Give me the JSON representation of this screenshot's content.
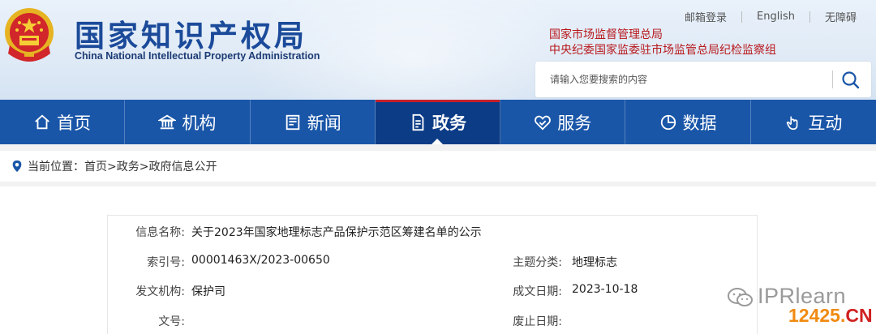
{
  "header": {
    "site_title": "国家知识产权局",
    "site_subtitle": "China National Intellectual Property Administration",
    "top_links": [
      "邮箱登录",
      "English",
      "无障碍"
    ],
    "org_line1": "国家市场监督管理总局",
    "org_line2": "中央纪委国家监委驻市场监管总局纪检监察组",
    "search_placeholder": "请输入您要搜索的内容"
  },
  "nav": {
    "items": [
      {
        "label": "首页",
        "icon": "home-icon"
      },
      {
        "label": "机构",
        "icon": "institution-icon"
      },
      {
        "label": "新闻",
        "icon": "news-icon"
      },
      {
        "label": "政务",
        "icon": "document-icon",
        "active": true
      },
      {
        "label": "服务",
        "icon": "service-icon"
      },
      {
        "label": "数据",
        "icon": "pie-chart-icon"
      },
      {
        "label": "互动",
        "icon": "interaction-icon"
      }
    ]
  },
  "breadcrumb": {
    "prefix": "当前位置：",
    "path": "首页>政务>政府信息公开"
  },
  "info": {
    "name_label": "信息名称:",
    "name_value": "关于2023年国家地理标志产品保护示范区筹建名单的公示",
    "index_label": "索引号:",
    "index_value": "00001463X/2023-00650",
    "category_label": "主题分类:",
    "category_value": "地理标志",
    "issuer_label": "发文机构:",
    "issuer_value": "保护司",
    "date_label": "成文日期:",
    "date_value": "2023-10-18",
    "docno_label": "文号:",
    "docno_value": "",
    "expire_label": "废止日期:",
    "expire_value": ""
  },
  "watermark": {
    "text1": "IPRlearn",
    "text2_num": "12425.",
    "text2_cn": "CN"
  },
  "colors": {
    "nav_bg": "#1a56a8",
    "nav_active": "#0c3c86",
    "title_blue": "#1b4a9a",
    "org_red": "#b8181c"
  }
}
